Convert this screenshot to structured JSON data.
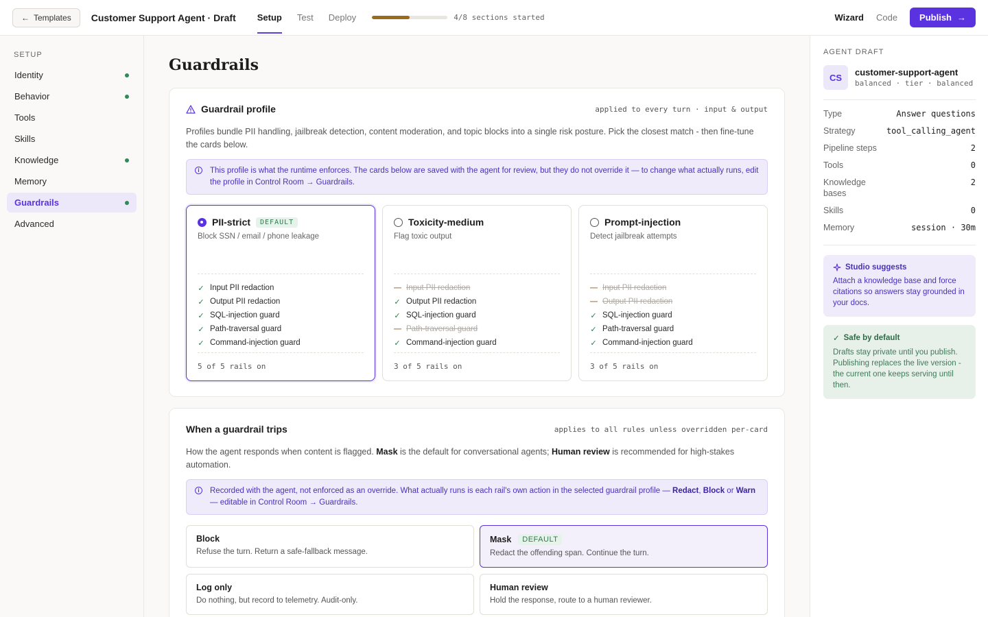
{
  "topbar": {
    "back_label": "Templates",
    "app_title": "Customer Support Agent · Draft",
    "tabs": [
      {
        "label": "Setup",
        "active": true
      },
      {
        "label": "Test",
        "active": false
      },
      {
        "label": "Deploy",
        "active": false
      }
    ],
    "progress": {
      "value": 0.5,
      "label": "4/8 sections started"
    },
    "wizard_label": "Wizard",
    "code_label": "Code",
    "publish_label": "Publish"
  },
  "sidebar": {
    "heading": "SETUP",
    "items": [
      {
        "label": "Identity",
        "done": true
      },
      {
        "label": "Behavior",
        "done": true
      },
      {
        "label": "Tools",
        "done": false
      },
      {
        "label": "Skills",
        "done": false
      },
      {
        "label": "Knowledge",
        "done": true
      },
      {
        "label": "Memory",
        "done": false
      },
      {
        "label": "Guardrails",
        "done": true,
        "active": true
      },
      {
        "label": "Advanced",
        "done": false
      }
    ]
  },
  "main": {
    "page_title": "Guardrails",
    "profile_card": {
      "title": "Guardrail profile",
      "meta": "applied to every turn · input & output",
      "description": "Profiles bundle PII handling, jailbreak detection, content moderation, and topic blocks into a single risk posture. Pick the closest match - then fine-tune the cards below.",
      "info": "This profile is what the runtime enforces. The cards below are saved with the agent for review, but they do not override it — to change what actually runs, edit the profile in Control Room → Guardrails.",
      "profiles": [
        {
          "name": "PII-strict",
          "badge": "DEFAULT",
          "selected": true,
          "subtitle": "Block SSN / email / phone leakage",
          "rails": [
            {
              "label": "Input PII redaction",
              "on": true
            },
            {
              "label": "Output PII redaction",
              "on": true
            },
            {
              "label": "SQL-injection guard",
              "on": true
            },
            {
              "label": "Path-traversal guard",
              "on": true
            },
            {
              "label": "Command-injection guard",
              "on": true
            }
          ],
          "count": "5 of 5 rails on"
        },
        {
          "name": "Toxicity-medium",
          "badge": "",
          "selected": false,
          "subtitle": "Flag toxic output",
          "rails": [
            {
              "label": "Input PII redaction",
              "on": false
            },
            {
              "label": "Output PII redaction",
              "on": true
            },
            {
              "label": "SQL-injection guard",
              "on": true
            },
            {
              "label": "Path-traversal guard",
              "on": false
            },
            {
              "label": "Command-injection guard",
              "on": true
            }
          ],
          "count": "3 of 5 rails on"
        },
        {
          "name": "Prompt-injection",
          "badge": "",
          "selected": false,
          "subtitle": "Detect jailbreak attempts",
          "rails": [
            {
              "label": "Input PII redaction",
              "on": false
            },
            {
              "label": "Output PII redaction",
              "on": false
            },
            {
              "label": "SQL-injection guard",
              "on": true
            },
            {
              "label": "Path-traversal guard",
              "on": true
            },
            {
              "label": "Command-injection guard",
              "on": true
            }
          ],
          "count": "3 of 5 rails on"
        }
      ]
    },
    "trips_card": {
      "title": "When a guardrail trips",
      "meta": "applies to all rules unless overridden per-card",
      "desc_pre": "How the agent responds when content is flagged. ",
      "desc_b1": "Mask",
      "desc_mid": " is the default for conversational agents; ",
      "desc_b2": "Human review",
      "desc_post": " is recommended for high-stakes automation.",
      "info_pre": "Recorded with the agent, not enforced as an override. What actually runs is each rail's own action in the selected guardrail profile — ",
      "info_b1": "Redact",
      "info_sep1": ", ",
      "info_b2": "Block",
      "info_sep2": " or ",
      "info_b3": "Warn",
      "info_post": " — editable in Control Room → Guardrails.",
      "actions": [
        {
          "name": "Block",
          "badge": "",
          "desc": "Refuse the turn. Return a safe-fallback message.",
          "selected": false
        },
        {
          "name": "Mask",
          "badge": "DEFAULT",
          "desc": "Redact the offending span. Continue the turn.",
          "selected": true
        },
        {
          "name": "Log only",
          "badge": "",
          "desc": "Do nothing, but record to telemetry. Audit-only.",
          "selected": false
        },
        {
          "name": "Human review",
          "badge": "",
          "desc": "Hold the response, route to a human reviewer.",
          "selected": false
        }
      ]
    }
  },
  "right_panel": {
    "heading": "AGENT DRAFT",
    "avatar": "CS",
    "agent_name": "customer-support-agent",
    "agent_tags": "balanced · tier · balanced",
    "stats": [
      {
        "key": "Type",
        "value": "Answer questions"
      },
      {
        "key": "Strategy",
        "value": "tool_calling_agent"
      },
      {
        "key": "Pipeline steps",
        "value": "2"
      },
      {
        "key": "Tools",
        "value": "0"
      },
      {
        "key": "Knowledge bases",
        "value": "2"
      },
      {
        "key": "Skills",
        "value": "0"
      },
      {
        "key": "Memory",
        "value": "session · 30m"
      }
    ],
    "suggest": {
      "title": "Studio suggests",
      "body": "Attach a knowledge base and force citations so answers stay grounded in your docs."
    },
    "safe": {
      "title": "Safe by default",
      "body": "Drafts stay private until you publish. Publishing replaces the live version - the current one keeps serving until then."
    }
  },
  "colors": {
    "accent": "#5b32e0",
    "progress": "#9a6a1e",
    "done_dot": "#2f8a58"
  }
}
